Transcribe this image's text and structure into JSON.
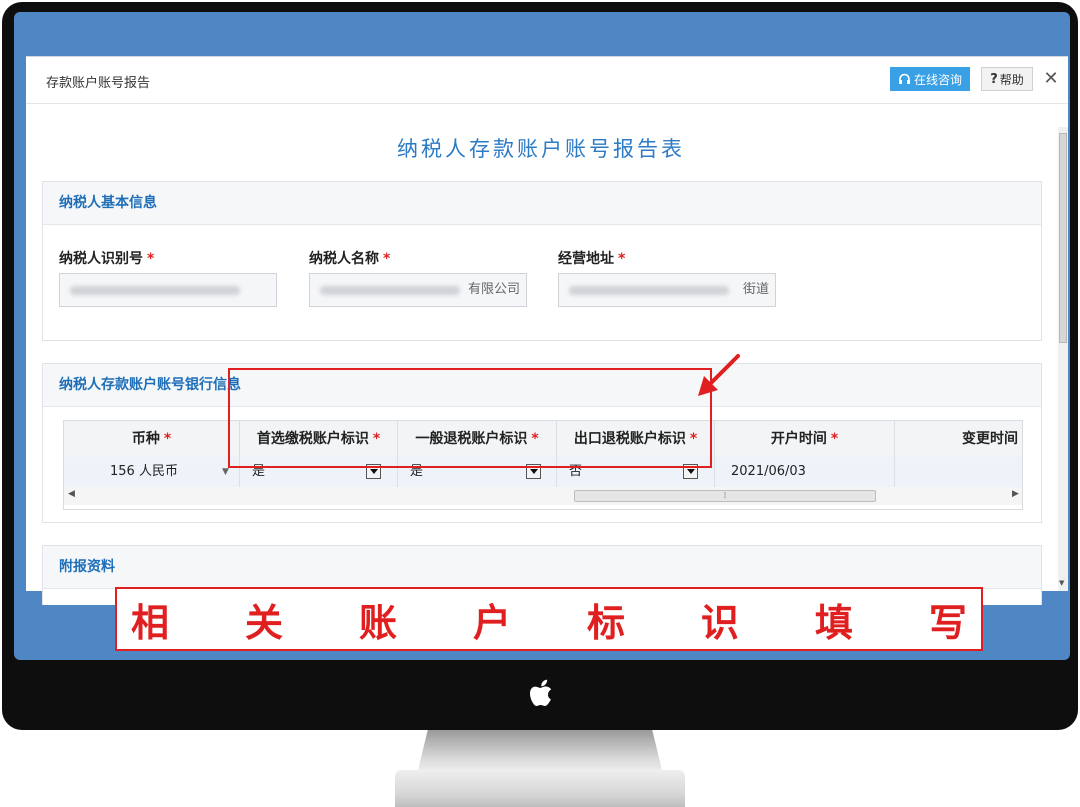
{
  "dialog": {
    "title": "存款账户账号报告",
    "consult_label": "在线咨询",
    "help_label": "帮助",
    "close_symbol": "✕"
  },
  "report_title": "纳税人存款账户账号报告表",
  "basic_info": {
    "header": "纳税人基本信息",
    "fields": [
      {
        "label": "纳税人识别号",
        "value": ""
      },
      {
        "label": "纳税人名称",
        "value": "有限公司"
      },
      {
        "label": "经营地址",
        "value": "街道"
      }
    ]
  },
  "bank_info": {
    "header": "纳税人存款账户账号银行信息",
    "columns": [
      "币种",
      "首选缴税账户标识",
      "一般退税账户标识",
      "出口退税账户标识",
      "开户时间",
      "变更时间"
    ],
    "row": {
      "currency": "156 人民币",
      "preferred_tax_account": "是",
      "general_refund_account": "是",
      "export_refund_account": "否",
      "open_date": "2021/06/03",
      "change_date": ""
    }
  },
  "attachments": {
    "header": "附报资料"
  },
  "caption": [
    "相",
    "关",
    "账",
    "户",
    "标",
    "识",
    "填",
    "写"
  ],
  "colors": {
    "accent": "#2d7bc5",
    "highlight": "#e02020",
    "screen_bg": "#4f86c4"
  }
}
